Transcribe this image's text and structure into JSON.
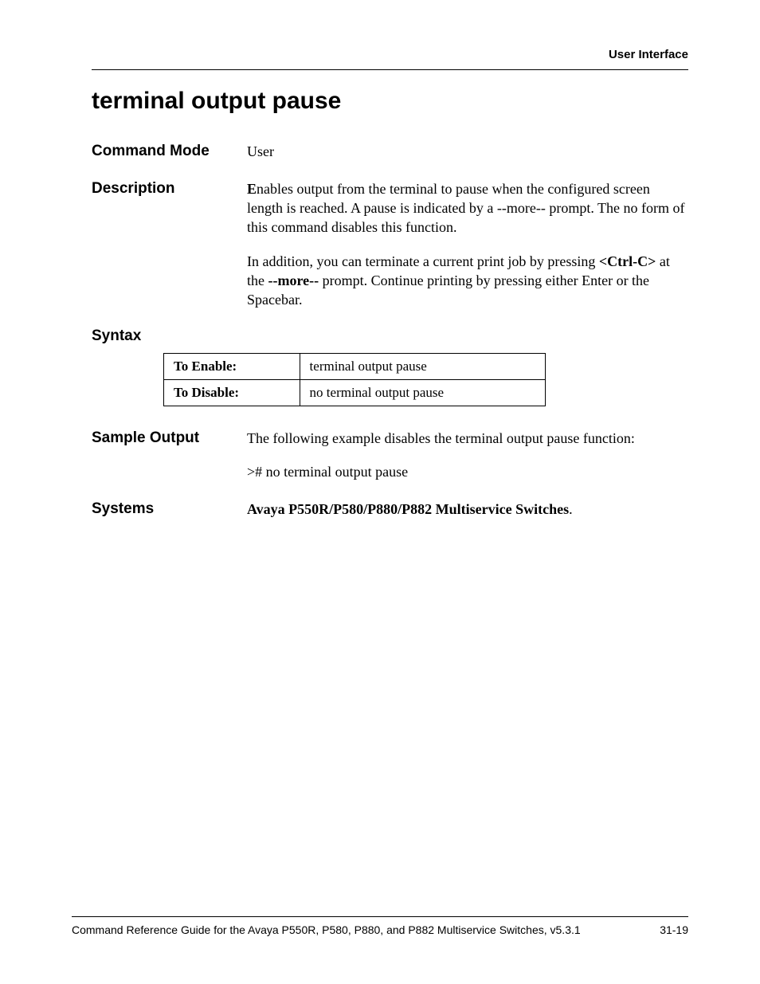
{
  "header": {
    "running_head": "User Interface"
  },
  "title": "terminal output pause",
  "command_mode": {
    "label": "Command Mode",
    "value": "User"
  },
  "description": {
    "label": "Description",
    "para1_dropcap": "E",
    "para1_rest": "nables output from the terminal to pause when the configured screen length is reached. A pause is indicated by a --more-- prompt. The no form of this command disables this function.",
    "para2_pre": "In addition, you can terminate a current print job by pressing ",
    "para2_key1": "<Ctrl-C>",
    "para2_mid": " at the ",
    "para2_key2": "--more--",
    "para2_post": " prompt. Continue printing by pressing either Enter or the Spacebar."
  },
  "syntax": {
    "label": "Syntax",
    "rows": [
      {
        "label": "To Enable:",
        "value": "terminal output pause"
      },
      {
        "label": "To Disable:",
        "value": "no terminal output pause"
      }
    ]
  },
  "sample_output": {
    "label": "Sample Output",
    "intro": "The following example disables the terminal output pause function:",
    "cmd": "># no terminal output pause"
  },
  "systems": {
    "label": "Systems",
    "value": "Avaya P550R/P580/P880/P882 Multiservice Switches",
    "suffix": "."
  },
  "footer": {
    "left": "Command Reference Guide for the Avaya P550R, P580, P880, and P882 Multiservice Switches, v5.3.1",
    "right": "31-19"
  }
}
